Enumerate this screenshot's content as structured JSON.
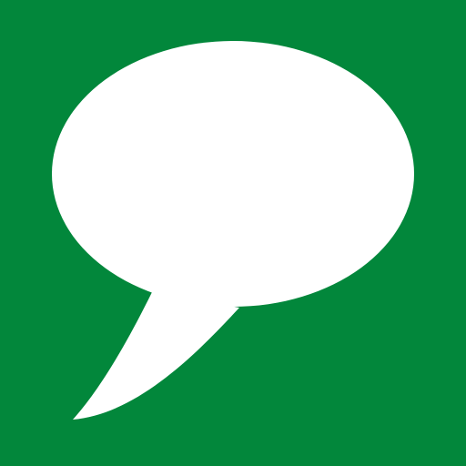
{
  "icon": {
    "name": "speech-bubble-icon",
    "background_color": "#02873B",
    "glyph_color": "#FFFFFF"
  }
}
